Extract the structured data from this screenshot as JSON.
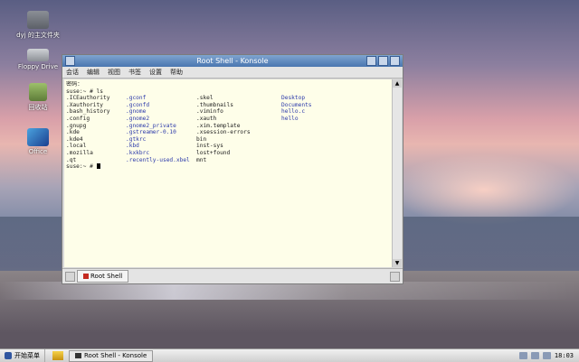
{
  "desktop": {
    "icons": [
      {
        "label": "dyj 的主文件夹",
        "icon": "home-folder-icon"
      },
      {
        "label": "Floppy Drive",
        "icon": "floppy-icon"
      },
      {
        "label": "回收站",
        "icon": "trash-icon"
      },
      {
        "label": "Office",
        "icon": "office-icon"
      }
    ]
  },
  "window": {
    "title": "Root Shell - Konsole",
    "menu": [
      "会话",
      "编辑",
      "视图",
      "书签",
      "设置",
      "帮助"
    ],
    "tab_label": "Root Shell"
  },
  "terminal": {
    "line1": "密码：",
    "prompt_ls": "suse:~ # ls",
    "columns": [
      [
        ".ICEauthority",
        ".Xauthority",
        ".bash_history",
        ".config",
        ".gnupg",
        ".kde",
        ".kde4",
        ".local",
        ".mozilla",
        ".qt"
      ],
      [
        ".gconf",
        ".gconfd",
        ".gnome",
        ".gnome2",
        ".gnome2_private",
        ".gstreamer-0.10",
        ".gtkrc",
        ".kbd",
        ".kxkbrc",
        ".recently-used.xbel"
      ],
      [
        ".skel",
        ".thumbnails",
        ".viminfo",
        ".xauth",
        ".xim.template",
        ".xsession-errors",
        "bin",
        "inst-sys",
        "lost+found",
        "mnt"
      ],
      [
        "Desktop",
        "Documents",
        "hello.c",
        "hello",
        "",
        "",
        "",
        "",
        "",
        ""
      ]
    ],
    "final_prompt": "suse:~ # "
  },
  "taskbar": {
    "start_label": "开始菜单",
    "task_label": "Root Shell - Konsole",
    "clock": "18:03"
  }
}
